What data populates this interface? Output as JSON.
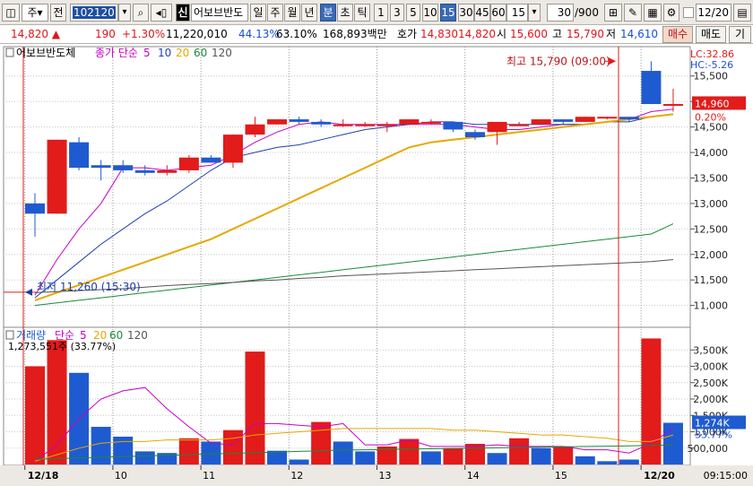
{
  "toolbar": {
    "market": "주",
    "full_label": "전",
    "code": "102120",
    "stock_name": "어보브반도",
    "sin_label": "신",
    "periods": [
      "일",
      "주",
      "월",
      "년",
      "분",
      "초",
      "틱"
    ],
    "active_period": "분",
    "intervals": [
      "1",
      "3",
      "5",
      "10",
      "15",
      "30",
      "45",
      "60"
    ],
    "active_interval": "15",
    "interval_value": "15",
    "count": "30",
    "count_total": "/900",
    "date": "12/20"
  },
  "quote": {
    "price": "14,820",
    "change": "190",
    "change_pct": "+1.30%",
    "volume": "11,220,010",
    "vol_ratio": "44.13%",
    "turnover": "63.10%",
    "amount": "168,893백만",
    "ask_label": "호가",
    "ask": "14,830",
    "bid": "14,820",
    "open_label": "시",
    "open": "15,600",
    "high_label": "고",
    "high": "15,790",
    "low_label": "저",
    "low": "14,610",
    "buy_label": "매수",
    "sell_label": "매도",
    "more_label": "기"
  },
  "chart_data": [
    {
      "type": "candlestick",
      "title": "어보브반도체",
      "legend_label": "종가 단순",
      "ma_periods": [
        5,
        10,
        20,
        60,
        120
      ],
      "ylim": [
        10800,
        15900
      ],
      "y_ticks": [
        11000,
        11500,
        12000,
        12500,
        13000,
        13500,
        14000,
        14500,
        15000,
        15500
      ],
      "y_tick_labels": [
        "11,000",
        "11,500",
        "12,000",
        "12,500",
        "13,000",
        "13,500",
        "14,000",
        "14,500",
        "15,000",
        "15,500"
      ],
      "x_day_labels": [
        {
          "index": 0,
          "label": "12/18"
        },
        {
          "index": 4,
          "label": "10"
        },
        {
          "index": 8,
          "label": "11"
        },
        {
          "index": 12,
          "label": "12"
        },
        {
          "index": 16,
          "label": "13"
        },
        {
          "index": 20,
          "label": "14"
        },
        {
          "index": 24,
          "label": "15"
        },
        {
          "index": 28,
          "label": "12/20"
        }
      ],
      "candles": [
        {
          "o": 13000,
          "h": 13200,
          "l": 12350,
          "c": 12800
        },
        {
          "o": 12800,
          "h": 14250,
          "l": 12800,
          "c": 14250
        },
        {
          "o": 14200,
          "h": 14300,
          "l": 13650,
          "c": 13700
        },
        {
          "o": 13750,
          "h": 13850,
          "l": 13450,
          "c": 13700
        },
        {
          "o": 13750,
          "h": 13850,
          "l": 13600,
          "c": 13650
        },
        {
          "o": 13650,
          "h": 13750,
          "l": 13550,
          "c": 13600
        },
        {
          "o": 13600,
          "h": 13750,
          "l": 13550,
          "c": 13650
        },
        {
          "o": 13650,
          "h": 13950,
          "l": 13600,
          "c": 13900
        },
        {
          "o": 13900,
          "h": 13950,
          "l": 13800,
          "c": 13800
        },
        {
          "o": 13800,
          "h": 14350,
          "l": 13700,
          "c": 14350
        },
        {
          "o": 14350,
          "h": 14700,
          "l": 14300,
          "c": 14550
        },
        {
          "o": 14550,
          "h": 14650,
          "l": 14550,
          "c": 14650
        },
        {
          "o": 14650,
          "h": 14700,
          "l": 14550,
          "c": 14600
        },
        {
          "o": 14600,
          "h": 14650,
          "l": 14500,
          "c": 14550
        },
        {
          "o": 14550,
          "h": 14650,
          "l": 14500,
          "c": 14550
        },
        {
          "o": 14550,
          "h": 14600,
          "l": 14500,
          "c": 14550
        },
        {
          "o": 14550,
          "h": 14600,
          "l": 14400,
          "c": 14550
        },
        {
          "o": 14550,
          "h": 14650,
          "l": 14550,
          "c": 14650
        },
        {
          "o": 14600,
          "h": 14650,
          "l": 14550,
          "c": 14600
        },
        {
          "o": 14600,
          "h": 14600,
          "l": 14400,
          "c": 14450
        },
        {
          "o": 14400,
          "h": 14450,
          "l": 14250,
          "c": 14300
        },
        {
          "o": 14400,
          "h": 14600,
          "l": 14150,
          "c": 14600
        },
        {
          "o": 14550,
          "h": 14600,
          "l": 14550,
          "c": 14550
        },
        {
          "o": 14550,
          "h": 14650,
          "l": 14550,
          "c": 14650
        },
        {
          "o": 14650,
          "h": 14650,
          "l": 14550,
          "c": 14600
        },
        {
          "o": 14600,
          "h": 14700,
          "l": 14600,
          "c": 14700
        },
        {
          "o": 14700,
          "h": 14700,
          "l": 14650,
          "c": 14700
        },
        {
          "o": 14700,
          "h": 14700,
          "l": 14600,
          "c": 14650
        },
        {
          "o": 15600,
          "h": 15790,
          "l": 14950,
          "c": 14950
        },
        {
          "o": 14950,
          "h": 15250,
          "l": 14800,
          "c": 14950
        }
      ],
      "series": [
        {
          "period": 5,
          "color": "#c800c8",
          "values": [
            11200,
            11900,
            12500,
            13000,
            13700,
            13700,
            13650,
            13700,
            13750,
            13950,
            14200,
            14400,
            14550,
            14600,
            14550,
            14550,
            14550,
            14550,
            14550,
            14550,
            14500,
            14450,
            14450,
            14500,
            14550,
            14550,
            14600,
            14650,
            14800,
            14850
          ]
        },
        {
          "period": 10,
          "color": "#1f3fb0",
          "values": [
            11150,
            11500,
            11850,
            12200,
            12500,
            12800,
            13050,
            13350,
            13650,
            13900,
            14000,
            14100,
            14150,
            14250,
            14350,
            14450,
            14500,
            14550,
            14600,
            14600,
            14550,
            14550,
            14550,
            14550,
            14550,
            14550,
            14600,
            14600,
            14700,
            14750
          ]
        },
        {
          "period": 20,
          "color": "#e6a800",
          "values": [
            11100,
            11250,
            11400,
            11550,
            11700,
            11850,
            12000,
            12150,
            12300,
            12500,
            12700,
            12900,
            13100,
            13300,
            13500,
            13700,
            13900,
            14100,
            14200,
            14250,
            14300,
            14350,
            14400,
            14450,
            14500,
            14550,
            14600,
            14650,
            14700,
            14750
          ]
        },
        {
          "period": 60,
          "color": "#1a8a3a",
          "values": [
            11000,
            11050,
            11100,
            11150,
            11200,
            11250,
            11300,
            11350,
            11400,
            11450,
            11500,
            11550,
            11600,
            11650,
            11700,
            11750,
            11800,
            11850,
            11900,
            11950,
            12000,
            12050,
            12100,
            12150,
            12200,
            12250,
            12300,
            12350,
            12400,
            12600
          ]
        },
        {
          "period": 120,
          "color": "#555555",
          "values": [
            11250,
            11270,
            11290,
            11310,
            11330,
            11360,
            11390,
            11410,
            11430,
            11450,
            11480,
            11500,
            11530,
            11550,
            11580,
            11600,
            11620,
            11640,
            11660,
            11680,
            11700,
            11720,
            11740,
            11760,
            11780,
            11800,
            11820,
            11840,
            11860,
            11900
          ]
        }
      ],
      "annotations": {
        "high": "최고 15,790 (09:00)",
        "low": "최저 11,260 (15:30)",
        "current_price": "14,960",
        "current_pct": "0.20%",
        "lc": "LC:32.86",
        "hc": "HC:-5.26"
      }
    },
    {
      "type": "bar",
      "title": "거래량",
      "legend_label": "단순",
      "ma_periods": [
        5,
        20,
        60,
        120
      ],
      "ylim": [
        0,
        4000000
      ],
      "y_ticks": [
        500000,
        1000000,
        1500000,
        2000000,
        2500000,
        3000000,
        3500000
      ],
      "y_tick_labels": [
        "500,000",
        "1,000K",
        "1,500K",
        "2,000K",
        "2,500K",
        "3,000K",
        "3,500K"
      ],
      "values": [
        3000000,
        3800000,
        2800000,
        1150000,
        850000,
        400000,
        350000,
        800000,
        700000,
        1050000,
        3450000,
        420000,
        150000,
        1300000,
        700000,
        400000,
        550000,
        780000,
        400000,
        500000,
        630000,
        350000,
        800000,
        500000,
        550000,
        250000,
        100000,
        150000,
        3850000,
        1274000
      ],
      "up": [
        true,
        true,
        false,
        false,
        false,
        false,
        false,
        true,
        false,
        true,
        true,
        false,
        false,
        true,
        false,
        false,
        true,
        true,
        false,
        true,
        true,
        false,
        true,
        false,
        true,
        false,
        false,
        false,
        true,
        false
      ],
      "series": [
        {
          "period": 5,
          "color": "#c800c8",
          "values": [
            100000,
            600000,
            1400000,
            2000000,
            2250000,
            2350000,
            1700000,
            1150000,
            650000,
            600000,
            1250000,
            1250000,
            1200000,
            1150000,
            1250000,
            600000,
            600000,
            750000,
            550000,
            550000,
            550000,
            600000,
            550000,
            550000,
            550000,
            450000,
            450000,
            350000,
            650000,
            1100000
          ]
        },
        {
          "period": 20,
          "color": "#e6a800",
          "values": [
            100000,
            300000,
            500000,
            650000,
            700000,
            700000,
            750000,
            750000,
            750000,
            800000,
            900000,
            950000,
            1000000,
            1050000,
            1100000,
            1100000,
            1100000,
            1100000,
            1100000,
            1050000,
            1050000,
            1000000,
            950000,
            900000,
            900000,
            850000,
            800000,
            700000,
            700000,
            900000
          ]
        },
        {
          "period": 60,
          "color": "#1a8a3a",
          "values": [
            150000,
            180000,
            200000,
            220000,
            240000,
            260000,
            280000,
            300000,
            320000,
            340000,
            360000,
            380000,
            400000,
            420000,
            440000,
            450000,
            460000,
            470000,
            480000,
            490000,
            500000,
            510000,
            520000,
            530000,
            540000,
            550000,
            560000,
            570000,
            580000,
            600000
          ]
        }
      ],
      "annotations": {
        "last_volume": "1,273,551주 (33.77%)",
        "tag_value": "1,274K",
        "tag_pct": "33.77%"
      }
    }
  ],
  "time_label": "09:15:00",
  "colors": {
    "up": "#e21b1b",
    "down": "#1f5bd0",
    "grid": "#c8c8c8",
    "frame": "#7a7a7a"
  }
}
